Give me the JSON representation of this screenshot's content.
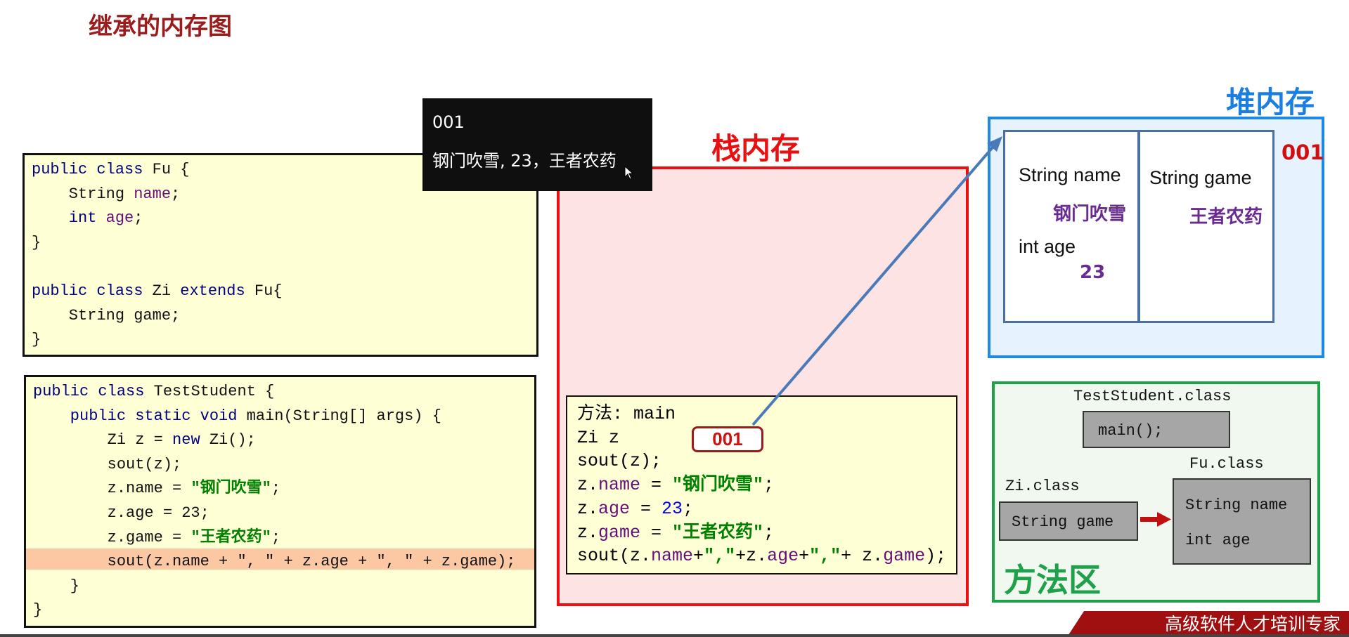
{
  "title": "继承的内存图",
  "tooltip": {
    "line1": "001",
    "line2": "钢门吹雪, 23，王者农药"
  },
  "fu_code": [
    [
      [
        "kw",
        "public class "
      ],
      [
        "",
        "Fu {"
      ]
    ],
    [
      [
        "",
        "    String "
      ],
      [
        "fd",
        "name"
      ],
      [
        "",
        ";"
      ]
    ],
    [
      [
        "kw",
        "    int "
      ],
      [
        "fd",
        "age"
      ],
      [
        "",
        ";"
      ]
    ],
    [
      [
        "",
        "}"
      ]
    ],
    [
      [
        "",
        ""
      ]
    ],
    [
      [
        "kw",
        "public class "
      ],
      [
        "",
        "Zi "
      ],
      [
        "kw",
        "extends "
      ],
      [
        "",
        "Fu{"
      ]
    ],
    [
      [
        "",
        "    String game;"
      ]
    ],
    [
      [
        "",
        "}"
      ]
    ]
  ],
  "test_code": [
    [
      [
        "kw",
        "public class "
      ],
      [
        "",
        "TestStudent {"
      ]
    ],
    [
      [
        "kw",
        "    public static void "
      ],
      [
        "",
        "main(String[] args) {"
      ]
    ],
    [
      [
        "",
        "        Zi z = "
      ],
      [
        "kw",
        "new "
      ],
      [
        "",
        "Zi();"
      ]
    ],
    [
      [
        "",
        "        sout(z);"
      ]
    ],
    [
      [
        "",
        "        z.name = "
      ],
      [
        "str",
        "\"钢门吹雪\""
      ],
      [
        "",
        ";"
      ]
    ],
    [
      [
        "",
        "        z.age = 23;"
      ]
    ],
    [
      [
        "",
        "        z.game = "
      ],
      [
        "str",
        "\"王者农药\""
      ],
      [
        "",
        ";"
      ]
    ],
    [
      [
        "",
        "        sout(z.name + \", \" + z.age + \", \" + z.game);"
      ]
    ],
    [
      [
        "",
        "    }"
      ]
    ],
    [
      [
        "",
        "}"
      ]
    ]
  ],
  "highlighted_line": 7,
  "stack": {
    "label": "栈内存",
    "method_code": [
      [
        [
          "",
          "方法: main"
        ]
      ],
      [
        [
          "",
          "Zi z"
        ]
      ],
      [
        [
          "",
          "sout(z);"
        ]
      ],
      [
        [
          "",
          "z."
        ],
        [
          "fd",
          "name"
        ],
        [
          "",
          " = "
        ],
        [
          "str",
          "\"钢门吹雪\""
        ],
        [
          "",
          ";"
        ]
      ],
      [
        [
          "",
          "z."
        ],
        [
          "fd",
          "age"
        ],
        [
          "",
          " = "
        ],
        [
          "num",
          "23"
        ],
        [
          "",
          ";"
        ]
      ],
      [
        [
          "",
          "z."
        ],
        [
          "fd",
          "game"
        ],
        [
          "",
          " = "
        ],
        [
          "str",
          "\"王者农药\""
        ],
        [
          "",
          ";"
        ]
      ],
      [
        [
          "",
          "sout(z."
        ],
        [
          "fd",
          "name"
        ],
        [
          "",
          "+"
        ],
        [
          "str",
          "\",\""
        ],
        [
          "",
          "+z."
        ],
        [
          "fd",
          "age"
        ],
        [
          "",
          "+"
        ],
        [
          "str",
          "\",\""
        ],
        [
          "",
          "+ z."
        ],
        [
          "fd",
          "game"
        ],
        [
          "",
          ");"
        ]
      ]
    ],
    "reference": "001"
  },
  "heap": {
    "label": "堆内存",
    "address": "001",
    "name_field": "String name",
    "name_value": "钢门吹雪",
    "age_field": "int age",
    "age_value": "23",
    "game_field": "String game",
    "game_value": "王者农药"
  },
  "method_area": {
    "label": "方法区",
    "test_class": "TestStudent.class",
    "main_method": "main();",
    "zi_class": "Zi.class",
    "zi_field": "String game",
    "fu_class": "Fu.class",
    "fu_field1": "String name",
    "fu_field2": "int age"
  },
  "banner": "高级软件人才培训专家",
  "colors": {
    "stack_border": "#e81010",
    "heap_border": "#1e88e5",
    "method_area_border": "#1fa04a",
    "title": "#9b1c1c",
    "value": "#6a2c91"
  }
}
